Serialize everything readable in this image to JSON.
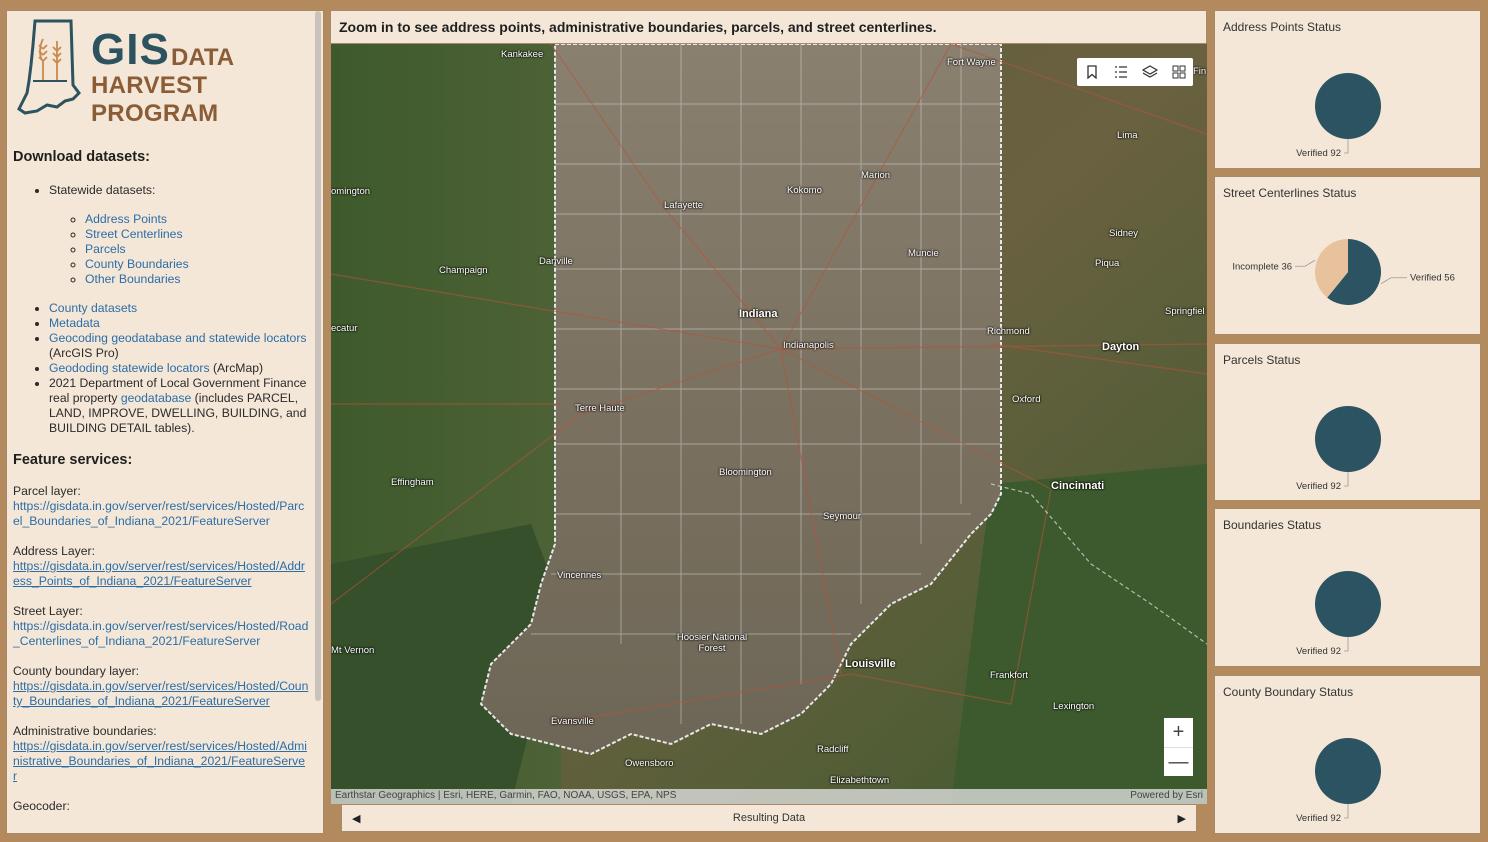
{
  "logo": {
    "gis": "GIS",
    "data": "DATA",
    "subtitle": "HARVEST PROGRAM"
  },
  "left": {
    "download_title": "Download datasets:",
    "statewide_label": "Statewide datasets:",
    "statewide_items": [
      "Address Points",
      "Street Centerlines",
      "Parcels",
      "County Boundaries",
      "Other Boundaries"
    ],
    "county_datasets": "County datasets",
    "metadata": "Metadata",
    "geocoding_link": "Geocoding geodatabase and statewide locators",
    "geocoding_suffix": " (ArcGIS Pro)",
    "geododing_link": "Geododing statewide locators",
    "geododing_suffix": " (ArcMap)",
    "dlgf_prefix": "2021 Department of Local Government Finance real property ",
    "dlgf_link": "geodatabase",
    "dlgf_suffix": " (includes PARCEL, LAND, IMPROVE, DWELLING, BUILDING, and BUILDING DETAIL tables).",
    "feature_title": "Feature services:",
    "services": [
      {
        "label": "Parcel layer:",
        "url": "https://gisdata.in.gov/server/rest/services/Hosted/Parcel_Boundaries_of_Indiana_2021/FeatureServer"
      },
      {
        "label": "Address Layer:",
        "url": "https://gisdata.in.gov/server/rest/services/Hosted/Address_Points_of_Indiana_2021/FeatureServer"
      },
      {
        "label": "Street Layer:",
        "url": "https://gisdata.in.gov/server/rest/services/Hosted/Road_Centerlines_of_Indiana_2021/FeatureServer"
      },
      {
        "label": "County boundary layer:",
        "url": "https://gisdata.in.gov/server/rest/services/Hosted/County_Boundaries_of_Indiana_2021/FeatureServer"
      },
      {
        "label": "Administrative boundaries:",
        "url": "https://gisdata.in.gov/server/rest/services/Hosted/Administrative_Boundaries_of_Indiana_2021/FeatureServer"
      }
    ],
    "geocoder_label": "Geocoder:"
  },
  "map": {
    "header": "Zoom in to see address points, administrative boundaries, parcels, and street centerlines.",
    "attribution_left": "Earthstar Geographics | Esri, HERE, Garmin, FAO, NOAA, USGS, EPA, NPS",
    "attribution_right": "Powered by Esri",
    "zoom_in": "+",
    "zoom_out": "—",
    "toolbar_icons": [
      "bookmark-icon",
      "list-icon",
      "layers-icon",
      "basemap-gallery-icon"
    ],
    "labels": [
      {
        "text": "Kankakee"
      },
      {
        "text": "Fort Wayne"
      },
      {
        "text": "Lima"
      },
      {
        "text": "omington"
      },
      {
        "text": "Lafayette"
      },
      {
        "text": "Kokomo"
      },
      {
        "text": "Marion"
      },
      {
        "text": "Sidney"
      },
      {
        "text": "Champaign"
      },
      {
        "text": "Danville"
      },
      {
        "text": "Muncie"
      },
      {
        "text": "Piqua"
      },
      {
        "text": "Springfiel"
      },
      {
        "text": "ecatur"
      },
      {
        "text": "Indiana"
      },
      {
        "text": "Richmond"
      },
      {
        "text": "Indianapolis"
      },
      {
        "text": "Dayton"
      },
      {
        "text": "Terre Haute"
      },
      {
        "text": "Oxford"
      },
      {
        "text": "Bloomington"
      },
      {
        "text": "Effingham"
      },
      {
        "text": "Cincinnati"
      },
      {
        "text": "Seymour"
      },
      {
        "text": "Vincennes"
      },
      {
        "text": "Hoosier National Forest"
      },
      {
        "text": "Mt Vernon"
      },
      {
        "text": "Louisville"
      },
      {
        "text": "Frankfort"
      },
      {
        "text": "Lexington"
      },
      {
        "text": "Evansville"
      },
      {
        "text": "Radcliff"
      },
      {
        "text": "Owensboro"
      },
      {
        "text": "Elizabethtown"
      },
      {
        "text": "Fin"
      }
    ]
  },
  "carousel": {
    "title": "Resulting Data",
    "prev": "◀",
    "next": "▶"
  },
  "status_cards": [
    {
      "title": "Address Points Status",
      "slices": [
        {
          "label": "Verified",
          "value": 92
        }
      ]
    },
    {
      "title": "Street Centerlines Status",
      "slices": [
        {
          "label": "Verified",
          "value": 56
        },
        {
          "label": "Incomplete",
          "value": 36
        }
      ]
    },
    {
      "title": "Parcels Status",
      "slices": [
        {
          "label": "Verified",
          "value": 92
        }
      ]
    },
    {
      "title": "Boundaries Status",
      "slices": [
        {
          "label": "Verified",
          "value": 92
        }
      ]
    },
    {
      "title": "County Boundary Status",
      "slices": [
        {
          "label": "Verified",
          "value": 92
        }
      ]
    }
  ],
  "chart_data": [
    {
      "type": "pie",
      "title": "Address Points Status",
      "categories": [
        "Verified"
      ],
      "values": [
        92
      ]
    },
    {
      "type": "pie",
      "title": "Street Centerlines Status",
      "categories": [
        "Verified",
        "Incomplete"
      ],
      "values": [
        56,
        36
      ]
    },
    {
      "type": "pie",
      "title": "Parcels Status",
      "categories": [
        "Verified"
      ],
      "values": [
        92
      ]
    },
    {
      "type": "pie",
      "title": "Boundaries Status",
      "categories": [
        "Verified"
      ],
      "values": [
        92
      ]
    },
    {
      "type": "pie",
      "title": "County Boundary Status",
      "categories": [
        "Verified"
      ],
      "values": [
        92
      ]
    }
  ],
  "colors": {
    "verified": "#2c5361",
    "incomplete": "#e8c29c",
    "panel_bg": "#f4e7d7",
    "frame": "#b38a5e",
    "link": "#2b6ea8"
  }
}
